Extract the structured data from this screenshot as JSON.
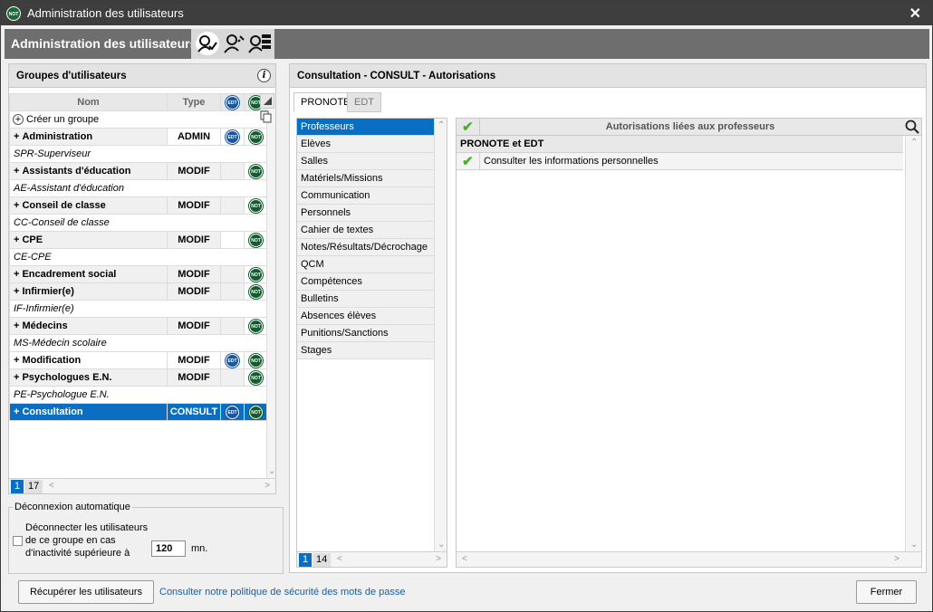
{
  "window": {
    "title": "Administration des utilisateurs",
    "logo": "NOT"
  },
  "header": {
    "title": "Administration des utilisateurs"
  },
  "groups": {
    "title": "Groupes d'utilisateurs",
    "columns": {
      "name": "Nom",
      "type": "Type",
      "edt": "EDT",
      "not": "NOT"
    },
    "create_label": "Créer un groupe",
    "rows": [
      {
        "kind": "group",
        "name": "Administration",
        "type": "ADMIN",
        "edt": true,
        "not": true,
        "white_edt": false
      },
      {
        "kind": "sub",
        "name": "SPR-Superviseur"
      },
      {
        "kind": "group",
        "name": "Assistants d'éducation",
        "type": "MODIF",
        "edt": false,
        "not": true,
        "white_edt": false
      },
      {
        "kind": "sub",
        "name": "AE-Assistant d'éducation"
      },
      {
        "kind": "group",
        "name": "Conseil de classe",
        "type": "MODIF",
        "edt": false,
        "not": true,
        "white_edt": false
      },
      {
        "kind": "sub",
        "name": "CC-Conseil de classe"
      },
      {
        "kind": "group",
        "name": "CPE",
        "type": "MODIF",
        "edt": false,
        "not": true,
        "white_edt": true
      },
      {
        "kind": "sub",
        "name": "CE-CPE"
      },
      {
        "kind": "group",
        "name": "Encadrement social",
        "type": "MODIF",
        "edt": false,
        "not": true,
        "white_edt": false
      },
      {
        "kind": "group",
        "name": "Infirmier(e)",
        "type": "MODIF",
        "edt": false,
        "not": true,
        "white_edt": false
      },
      {
        "kind": "sub",
        "name": "IF-Infirmier(e)"
      },
      {
        "kind": "group",
        "name": "Médecins",
        "type": "MODIF",
        "edt": false,
        "not": true,
        "white_edt": false
      },
      {
        "kind": "sub",
        "name": "MS-Médecin scolaire"
      },
      {
        "kind": "group",
        "name": "Modification",
        "type": "MODIF",
        "edt": true,
        "not": true,
        "white_edt": false,
        "white_name": true
      },
      {
        "kind": "group",
        "name": "Psychologues E.N.",
        "type": "MODIF",
        "edt": false,
        "not": true,
        "white_edt": false
      },
      {
        "kind": "sub",
        "name": "PE-Psychologue E.N."
      },
      {
        "kind": "selected",
        "name": "Consultation",
        "type": "CONSULT",
        "edt": true,
        "not": true
      }
    ],
    "pager": {
      "current": "1",
      "total": "17"
    }
  },
  "auto_logout": {
    "legend": "Déconnexion automatique",
    "label_line1": "Déconnecter les utilisateurs",
    "label_line2": "de ce groupe en cas",
    "label_line3": "d'inactivité supérieure à",
    "value": "120",
    "unit": "mn.",
    "checked": false
  },
  "right": {
    "title": "Consultation - CONSULT - Autorisations",
    "tabs": [
      "PRONOTE",
      "EDT"
    ],
    "active_tab": "PRONOTE",
    "categories": [
      "Professeurs",
      "Elèves",
      "Salles",
      "Matériels/Missions",
      "Communication",
      "Personnels",
      "Cahier de textes",
      "Notes/Résultats/Décrochage",
      "QCM",
      "Compétences",
      "Bulletins",
      "Absences élèves",
      "Punitions/Sanctions",
      "Stages"
    ],
    "active_category": "Professeurs",
    "cat_pager": {
      "current": "1",
      "total": "14"
    },
    "auth_header": "Autorisations liées aux professeurs",
    "section_label": "PRONOTE et EDT",
    "permissions": [
      {
        "label": "Consulter les informations personnelles",
        "checked": true
      }
    ]
  },
  "footer": {
    "recover_button": "Récupérer les utilisateurs",
    "policy_link": "Consulter notre politique de sécurité des mots de passe",
    "close_button": "Fermer"
  },
  "colors": {
    "accent": "#0a6fc2",
    "check": "#4cae2d",
    "not_badge": "#145c2f",
    "edt_badge": "#1a56a0"
  }
}
